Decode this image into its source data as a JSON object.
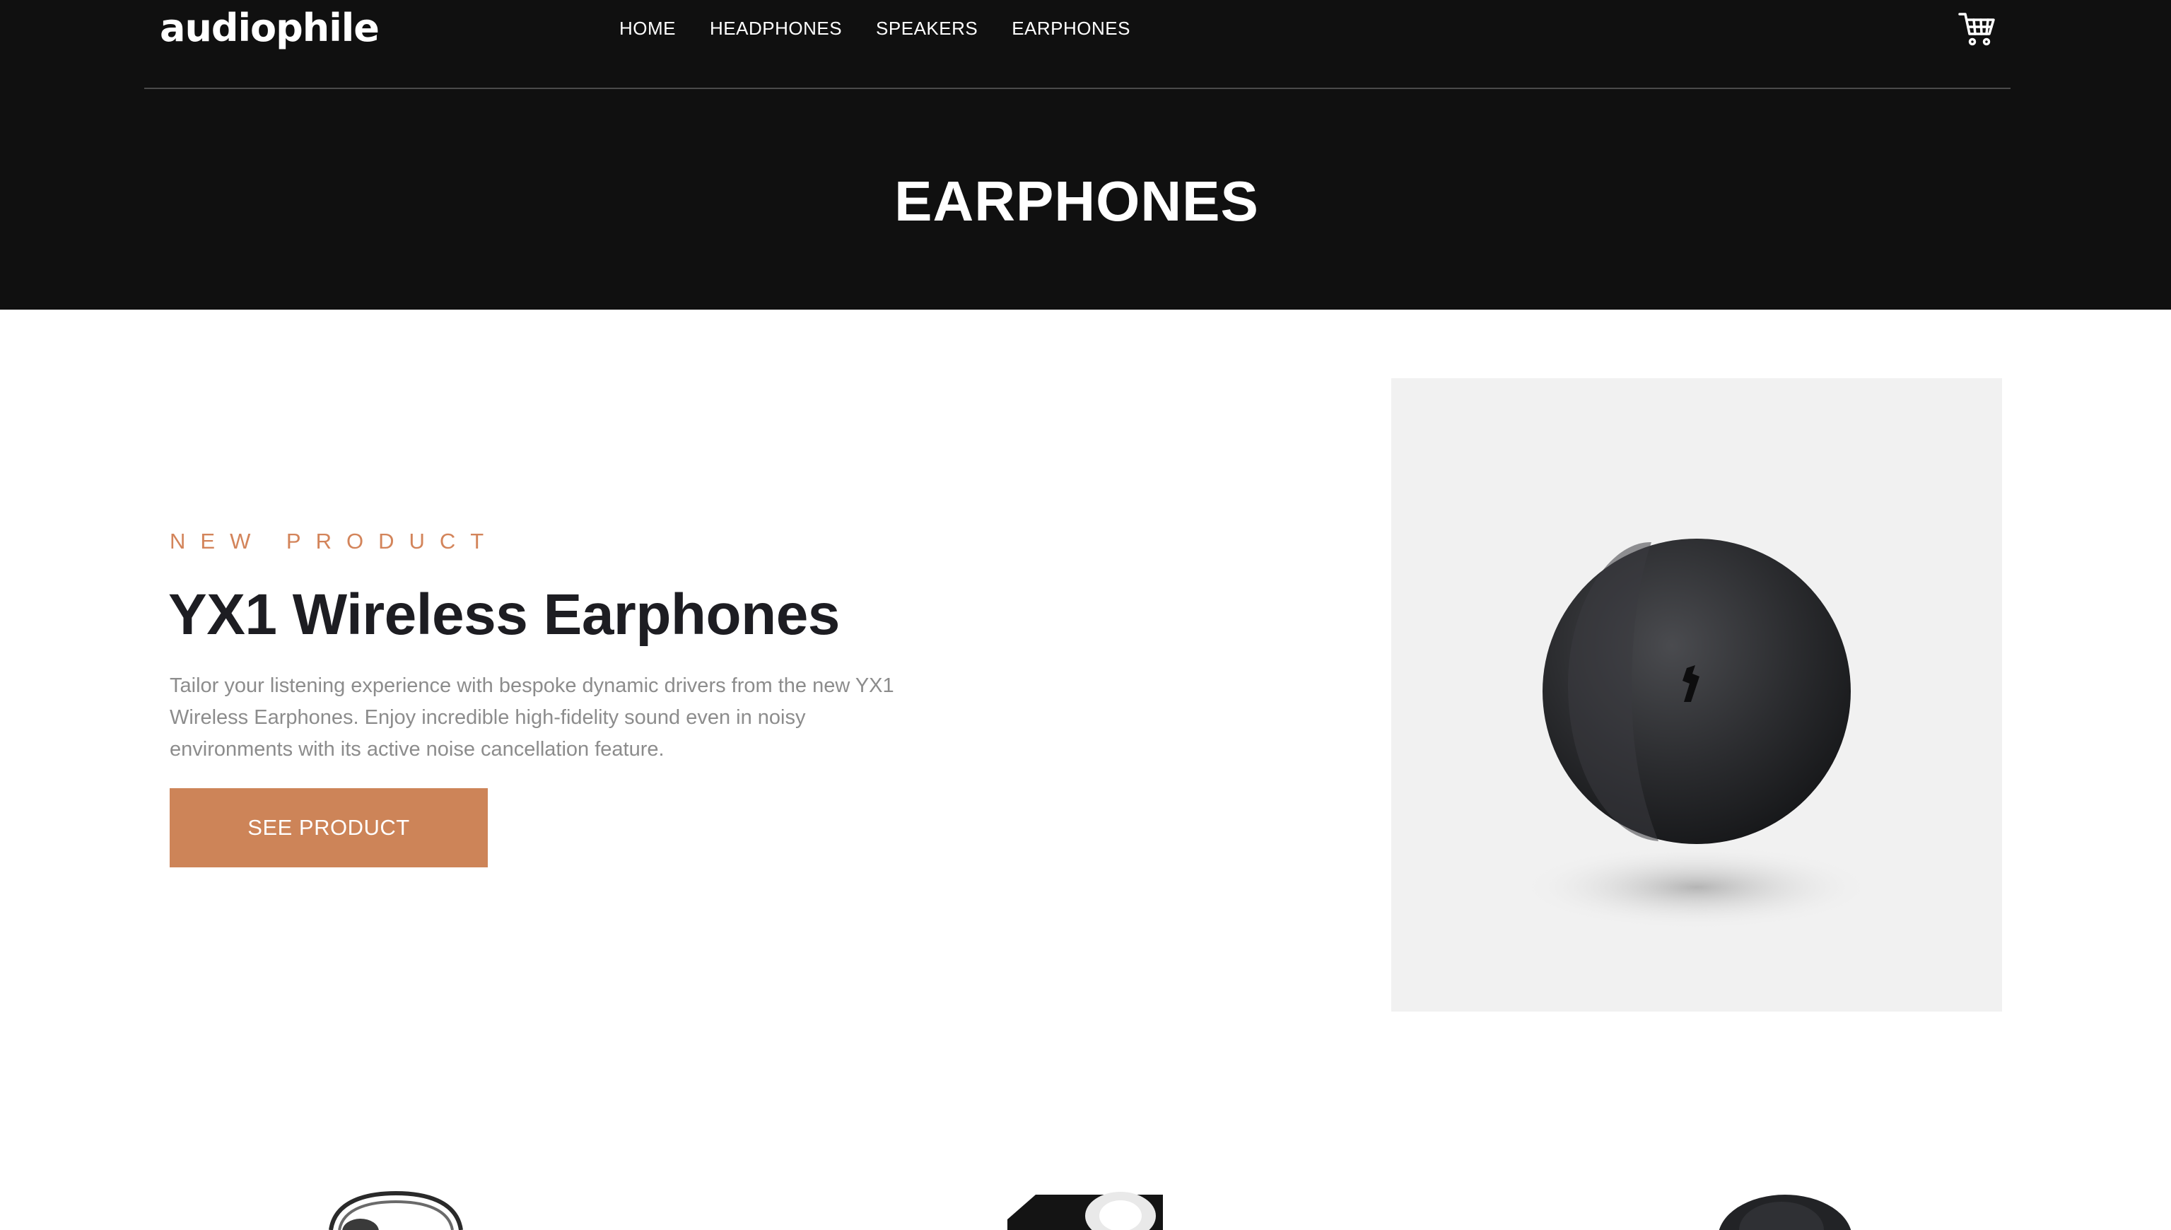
{
  "header": {
    "logo": "audiophile",
    "nav": [
      {
        "label": "HOME"
      },
      {
        "label": "HEADPHONES"
      },
      {
        "label": "SPEAKERS"
      },
      {
        "label": "EARPHONES"
      }
    ],
    "cart_icon": "cart-icon",
    "page_title": "EARPHONES"
  },
  "product": {
    "overline": "NEW PRODUCT",
    "name": "YX1 Wireless Earphones",
    "description": "Tailor your listening experience with bespoke dynamic drivers from the new YX1 Wireless Earphones. Enjoy incredible high-fidelity sound even in noisy environments with its active noise cancellation feature.",
    "cta_label": "SEE PRODUCT",
    "image": "earphone-product-image"
  },
  "categories": [
    {
      "image": "headphones-thumbnail"
    },
    {
      "image": "speaker-thumbnail"
    },
    {
      "image": "earphones-thumbnail"
    }
  ],
  "colors": {
    "header_bg": "#101010",
    "accent": "#d87d4a",
    "product_bg": "#f1f1f1",
    "heading": "#1d1d22",
    "body_text": "#8c8c8c"
  }
}
